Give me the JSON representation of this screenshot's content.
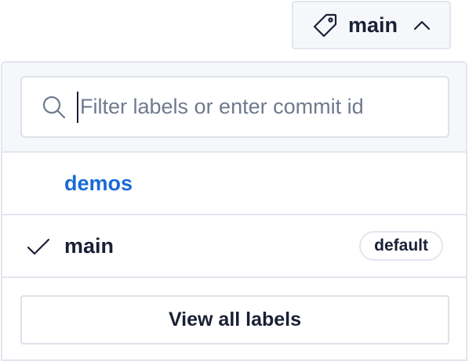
{
  "label_button": {
    "text": "main",
    "icon": "tag-icon",
    "chevron": "chevron-up-icon"
  },
  "dropdown": {
    "search": {
      "placeholder": "Filter labels or enter commit id",
      "value": "",
      "icon": "search-icon"
    },
    "options": [
      {
        "label": "demos",
        "selected": false,
        "color": "#1b6ad8"
      },
      {
        "label": "main",
        "selected": true,
        "badge": "default",
        "icon": "checkmark-icon"
      }
    ],
    "view_all_label": "View all labels"
  }
}
